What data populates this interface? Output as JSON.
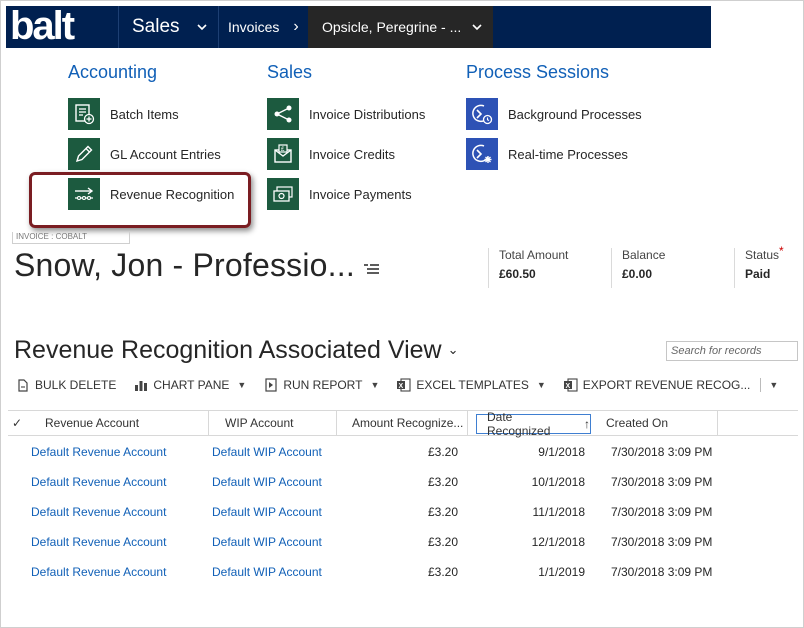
{
  "nav": {
    "area_label": "Sales",
    "entity_label": "Invoices",
    "record_label": "Opsicle, Peregrine - ..."
  },
  "menu": {
    "columns": [
      {
        "heading": "Accounting",
        "items": [
          "Batch Items",
          "GL Account Entries",
          "Revenue Recognition"
        ]
      },
      {
        "heading": "Sales",
        "items": [
          "Invoice Distributions",
          "Invoice Credits",
          "Invoice Payments"
        ]
      },
      {
        "heading": "Process Sessions",
        "items": [
          "Background Processes",
          "Real-time Processes"
        ]
      }
    ]
  },
  "record": {
    "form_label": "INVOICE : COBALT",
    "title": "Snow, Jon - Professio...",
    "header_fields": [
      {
        "label": "Total Amount",
        "value": "£60.50",
        "required": false
      },
      {
        "label": "Balance",
        "value": "£0.00",
        "required": false
      },
      {
        "label": "Status",
        "value": "Paid",
        "required": true,
        "required_mark": "*"
      }
    ]
  },
  "view": {
    "title": "Revenue Recognition Associated View",
    "search_placeholder": "Search for records",
    "toolbar": [
      "BULK DELETE",
      "CHART PANE",
      "RUN REPORT",
      "EXCEL TEMPLATES",
      "EXPORT REVENUE RECOG..."
    ],
    "columns": [
      "Revenue Account",
      "WIP Account",
      "Amount Recognize...",
      "Date Recognized",
      "Created On"
    ],
    "rows": [
      {
        "revenue_account": "Default Revenue Account",
        "wip_account": "Default WIP Account",
        "amount": "£3.20",
        "date_recognized": "9/1/2018",
        "created_on": "7/30/2018 3:09 PM"
      },
      {
        "revenue_account": "Default Revenue Account",
        "wip_account": "Default WIP Account",
        "amount": "£3.20",
        "date_recognized": "10/1/2018",
        "created_on": "7/30/2018 3:09 PM"
      },
      {
        "revenue_account": "Default Revenue Account",
        "wip_account": "Default WIP Account",
        "amount": "£3.20",
        "date_recognized": "11/1/2018",
        "created_on": "7/30/2018 3:09 PM"
      },
      {
        "revenue_account": "Default Revenue Account",
        "wip_account": "Default WIP Account",
        "amount": "£3.20",
        "date_recognized": "12/1/2018",
        "created_on": "7/30/2018 3:09 PM"
      },
      {
        "revenue_account": "Default Revenue Account",
        "wip_account": "Default WIP Account",
        "amount": "£3.20",
        "date_recognized": "1/1/2019",
        "created_on": "7/30/2018 3:09 PM"
      }
    ]
  },
  "colors": {
    "nav_bg": "#002050",
    "record_tab_bg": "#262626",
    "link": "#1160b7",
    "accounting_icon_bg": "#1c5a3f",
    "process_icon_bg": "#2d52b5",
    "highlight_border": "#7a1d22"
  }
}
